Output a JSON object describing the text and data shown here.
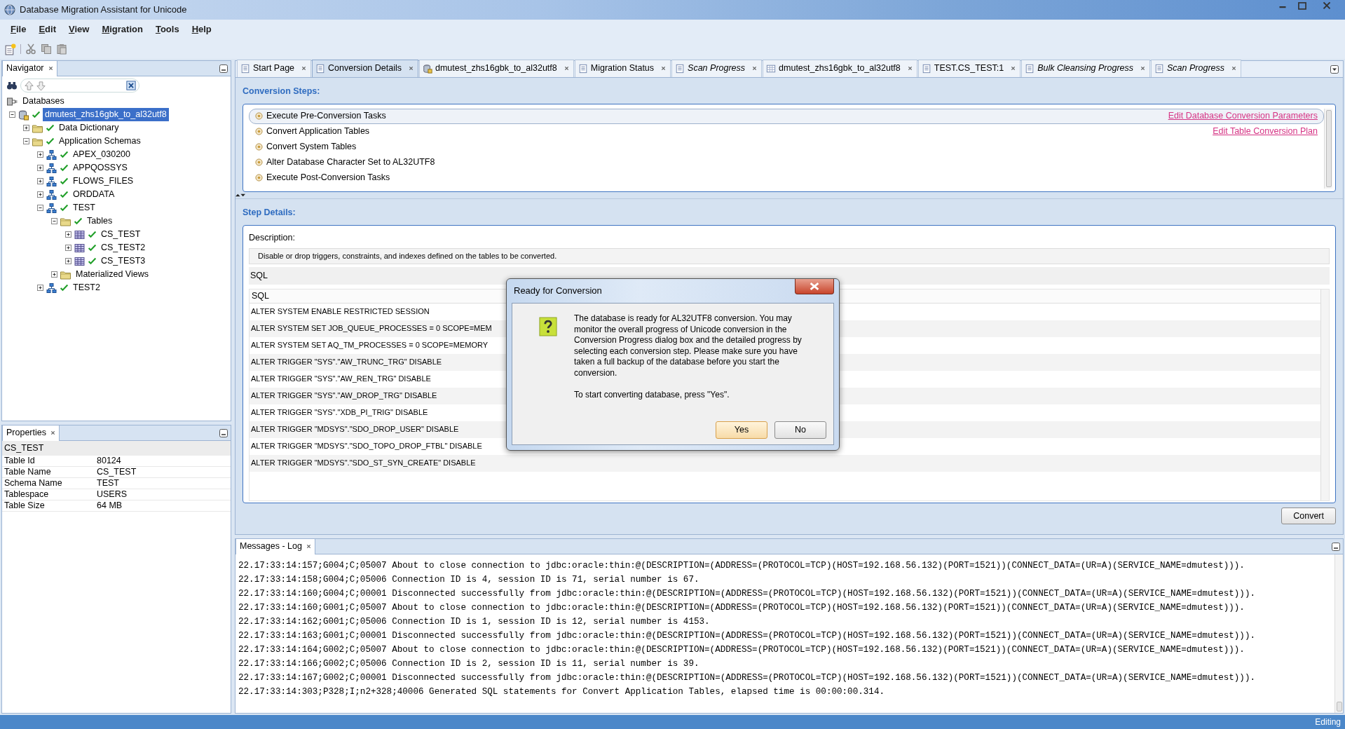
{
  "window": {
    "title": "Database Migration Assistant for Unicode"
  },
  "menu": [
    "File",
    "Edit",
    "View",
    "Migration",
    "Tools",
    "Help"
  ],
  "navigator": {
    "title": "Navigator",
    "tree": [
      {
        "label": "Databases",
        "kind": "root",
        "checked": false,
        "selected": false,
        "children": [
          {
            "label": "dmutest_zhs16gbk_to_al32utf8",
            "kind": "database",
            "checked": true,
            "selected": true,
            "expanded": true,
            "children": [
              {
                "label": "Data Dictionary",
                "kind": "folder",
                "checked": true,
                "selected": false,
                "expanded": false
              },
              {
                "label": "Application Schemas",
                "kind": "folder",
                "checked": true,
                "selected": false,
                "expanded": true,
                "children": [
                  {
                    "label": "APEX_030200",
                    "kind": "schema",
                    "checked": true,
                    "selected": false,
                    "expanded": false
                  },
                  {
                    "label": "APPQOSSYS",
                    "kind": "schema",
                    "checked": true,
                    "selected": false,
                    "expanded": false
                  },
                  {
                    "label": "FLOWS_FILES",
                    "kind": "schema",
                    "checked": true,
                    "selected": false,
                    "expanded": false
                  },
                  {
                    "label": "ORDDATA",
                    "kind": "schema",
                    "checked": true,
                    "selected": false,
                    "expanded": false
                  },
                  {
                    "label": "TEST",
                    "kind": "schema",
                    "checked": true,
                    "selected": false,
                    "expanded": true,
                    "children": [
                      {
                        "label": "Tables",
                        "kind": "folder",
                        "checked": true,
                        "selected": false,
                        "expanded": true,
                        "children": [
                          {
                            "label": "CS_TEST",
                            "kind": "table",
                            "checked": true,
                            "selected": false,
                            "expanded": false
                          },
                          {
                            "label": "CS_TEST2",
                            "kind": "table",
                            "checked": true,
                            "selected": false,
                            "expanded": false
                          },
                          {
                            "label": "CS_TEST3",
                            "kind": "table",
                            "checked": true,
                            "selected": false,
                            "expanded": false
                          }
                        ]
                      },
                      {
                        "label": "Materialized Views",
                        "kind": "folder",
                        "checked": false,
                        "selected": false,
                        "expanded": false
                      }
                    ]
                  },
                  {
                    "label": "TEST2",
                    "kind": "schema",
                    "checked": true,
                    "selected": false,
                    "expanded": false
                  }
                ]
              }
            ]
          }
        ]
      }
    ]
  },
  "properties": {
    "title": "Properties",
    "heading": "CS_TEST",
    "rows": [
      {
        "name": "Table Id",
        "value": "80124"
      },
      {
        "name": "Table Name",
        "value": "CS_TEST"
      },
      {
        "name": "Schema Name",
        "value": "TEST"
      },
      {
        "name": "Tablespace",
        "value": "USERS"
      },
      {
        "name": "Table Size",
        "value": "64 MB"
      }
    ]
  },
  "tabs": [
    {
      "label": "Start Page",
      "kind": "document",
      "italic": false,
      "selected": false
    },
    {
      "label": "Conversion Details",
      "kind": "document",
      "italic": false,
      "selected": true
    },
    {
      "label": "dmutest_zhs16gbk_to_al32utf8",
      "kind": "database",
      "italic": false,
      "selected": false
    },
    {
      "label": "Migration Status",
      "kind": "document",
      "italic": false,
      "selected": false
    },
    {
      "label": "Scan Progress",
      "kind": "document",
      "italic": true,
      "selected": false
    },
    {
      "label": "dmutest_zhs16gbk_to_al32utf8",
      "kind": "grid",
      "italic": false,
      "selected": false
    },
    {
      "label": "TEST.CS_TEST:1",
      "kind": "document",
      "italic": false,
      "selected": false
    },
    {
      "label": "Bulk Cleansing Progress",
      "kind": "document",
      "italic": true,
      "selected": false
    },
    {
      "label": "Scan Progress",
      "kind": "document",
      "italic": true,
      "selected": false
    }
  ],
  "conversion_steps": {
    "title": "Conversion Steps:",
    "steps": [
      {
        "label": "Execute Pre-Conversion Tasks",
        "selected": true,
        "link": "Edit Database Conversion Parameters"
      },
      {
        "label": "Convert Application Tables",
        "selected": false,
        "link": "Edit Table Conversion Plan"
      },
      {
        "label": "Convert System Tables",
        "selected": false
      },
      {
        "label": "Alter Database Character Set to AL32UTF8",
        "selected": false
      },
      {
        "label": "Execute Post-Conversion Tasks",
        "selected": false
      }
    ]
  },
  "step_details": {
    "title": "Step Details:",
    "description_label": "Description:",
    "description": "Disable or drop triggers, constraints, and indexes defined on the tables to be converted.",
    "sql_label": "SQL",
    "sql_column": "SQL",
    "sql_rows": [
      "ALTER SYSTEM ENABLE RESTRICTED SESSION",
      "ALTER SYSTEM SET JOB_QUEUE_PROCESSES = 0 SCOPE=MEM",
      "ALTER SYSTEM SET AQ_TM_PROCESSES = 0 SCOPE=MEMORY",
      "ALTER TRIGGER \"SYS\".\"AW_TRUNC_TRG\" DISABLE",
      "ALTER TRIGGER \"SYS\".\"AW_REN_TRG\" DISABLE",
      "ALTER TRIGGER \"SYS\".\"AW_DROP_TRG\" DISABLE",
      "ALTER TRIGGER \"SYS\".\"XDB_PI_TRIG\" DISABLE",
      "ALTER TRIGGER \"MDSYS\".\"SDO_DROP_USER\" DISABLE",
      "ALTER TRIGGER \"MDSYS\".\"SDO_TOPO_DROP_FTBL\" DISABLE",
      "ALTER TRIGGER \"MDSYS\".\"SDO_ST_SYN_CREATE\" DISABLE"
    ],
    "button": "Convert"
  },
  "messages": {
    "title": "Messages - Log",
    "lines": [
      "22.17:33:14:157;G004;C;05007 About to close connection to jdbc:oracle:thin:@(DESCRIPTION=(ADDRESS=(PROTOCOL=TCP)(HOST=192.168.56.132)(PORT=1521))(CONNECT_DATA=(UR=A)(SERVICE_NAME=dmutest))).",
      "22.17:33:14:158;G004;C;05006 Connection ID is 4, session ID is 71, serial number is 67.",
      "22.17:33:14:160;G004;C;00001 Disconnected successfully from jdbc:oracle:thin:@(DESCRIPTION=(ADDRESS=(PROTOCOL=TCP)(HOST=192.168.56.132)(PORT=1521))(CONNECT_DATA=(UR=A)(SERVICE_NAME=dmutest))).",
      "22.17:33:14:160;G001;C;05007 About to close connection to jdbc:oracle:thin:@(DESCRIPTION=(ADDRESS=(PROTOCOL=TCP)(HOST=192.168.56.132)(PORT=1521))(CONNECT_DATA=(UR=A)(SERVICE_NAME=dmutest))).",
      "22.17:33:14:162;G001;C;05006 Connection ID is 1, session ID is 12, serial number is 4153.",
      "22.17:33:14:163;G001;C;00001 Disconnected successfully from jdbc:oracle:thin:@(DESCRIPTION=(ADDRESS=(PROTOCOL=TCP)(HOST=192.168.56.132)(PORT=1521))(CONNECT_DATA=(UR=A)(SERVICE_NAME=dmutest))).",
      "22.17:33:14:164;G002;C;05007 About to close connection to jdbc:oracle:thin:@(DESCRIPTION=(ADDRESS=(PROTOCOL=TCP)(HOST=192.168.56.132)(PORT=1521))(CONNECT_DATA=(UR=A)(SERVICE_NAME=dmutest))).",
      "22.17:33:14:166;G002;C;05006 Connection ID is 2, session ID is 11, serial number is 39.",
      "22.17:33:14:167;G002;C;00001 Disconnected successfully from jdbc:oracle:thin:@(DESCRIPTION=(ADDRESS=(PROTOCOL=TCP)(HOST=192.168.56.132)(PORT=1521))(CONNECT_DATA=(UR=A)(SERVICE_NAME=dmutest))).",
      "22.17:33:14:303;P328;I;n2+328;40006 Generated SQL statements for Convert Application Tables, elapsed time is 00:00:00.314."
    ]
  },
  "status_bar": {
    "text": "Editing"
  },
  "dialog": {
    "title": "Ready for Conversion",
    "message": "The database is ready for AL32UTF8 conversion. You may monitor the overall progress of Unicode conversion in the Conversion Progress dialog box and the detailed progress by selecting each conversion step. Please make sure you have taken a full backup of the database before you start the conversion.",
    "prompt": "To start converting database, press \"Yes\".",
    "buttons": [
      {
        "label": "Yes",
        "default": true
      },
      {
        "label": "No",
        "default": false
      }
    ]
  }
}
